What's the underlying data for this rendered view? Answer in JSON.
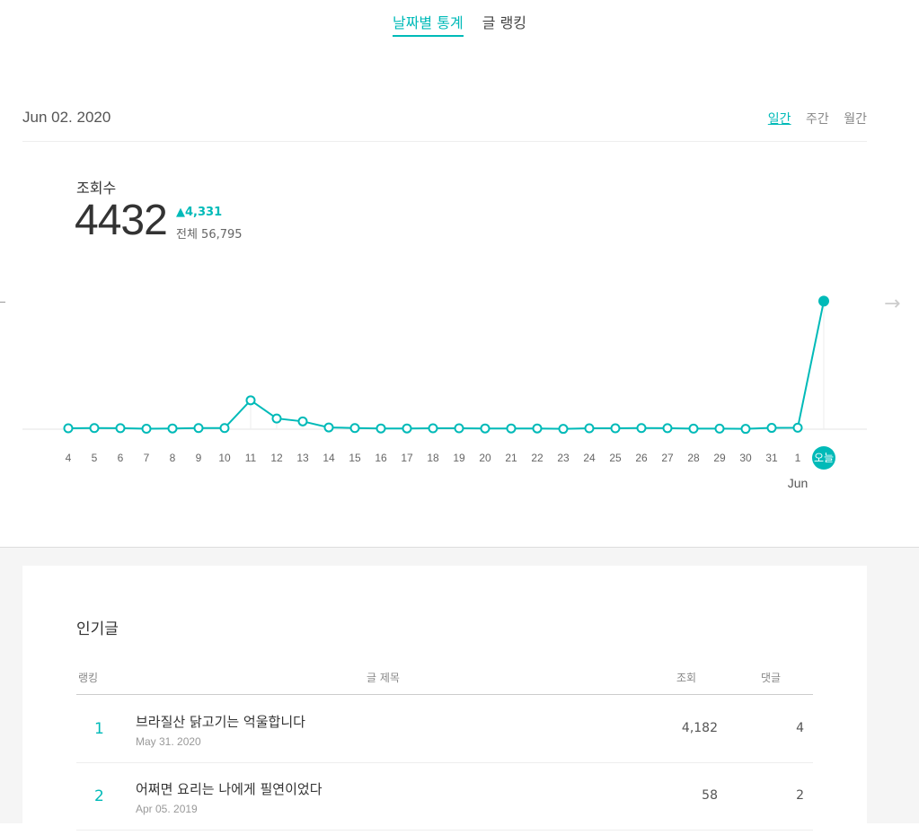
{
  "tabs": [
    {
      "label": "날짜별 통계",
      "active": true
    },
    {
      "label": "글 랭킹",
      "active": false
    }
  ],
  "date_title": "Jun 02. 2020",
  "period_tabs": [
    {
      "label": "일간",
      "active": true
    },
    {
      "label": "주간",
      "active": false
    },
    {
      "label": "월간",
      "active": false
    }
  ],
  "stats": {
    "label": "조회수",
    "value": "4432",
    "delta": "▲4,331",
    "total": "전체 56,795"
  },
  "colors": {
    "accent": "#00bab8"
  },
  "nav_icons": {
    "prev": "arrow-left-icon",
    "next": "arrow-right-icon"
  },
  "chart_data": {
    "type": "line",
    "x": [
      "4",
      "5",
      "6",
      "7",
      "8",
      "9",
      "10",
      "11",
      "12",
      "13",
      "14",
      "15",
      "16",
      "17",
      "18",
      "19",
      "20",
      "21",
      "22",
      "23",
      "24",
      "25",
      "26",
      "27",
      "28",
      "29",
      "30",
      "31",
      "1",
      "오늘"
    ],
    "values": [
      30,
      40,
      35,
      15,
      25,
      40,
      40,
      1000,
      370,
      270,
      60,
      40,
      25,
      25,
      30,
      30,
      25,
      25,
      25,
      10,
      30,
      30,
      40,
      35,
      20,
      20,
      10,
      45,
      50,
      4432
    ],
    "month_label": "Jun",
    "today_label": "오늘",
    "ylim": [
      0,
      4600
    ],
    "grid": false
  },
  "popular": {
    "title": "인기글",
    "headers": {
      "rank": "랭킹",
      "title": "글 제목",
      "views": "조회",
      "comments": "댓글"
    },
    "rows": [
      {
        "rank": "1",
        "title": "브라질산 닭고기는 억울합니다",
        "date": "May 31. 2020",
        "views": "4,182",
        "comments": "4"
      },
      {
        "rank": "2",
        "title": "어쩌면 요리는 나에게 필연이었다",
        "date": "Apr 05. 2019",
        "views": "58",
        "comments": "2"
      }
    ]
  }
}
